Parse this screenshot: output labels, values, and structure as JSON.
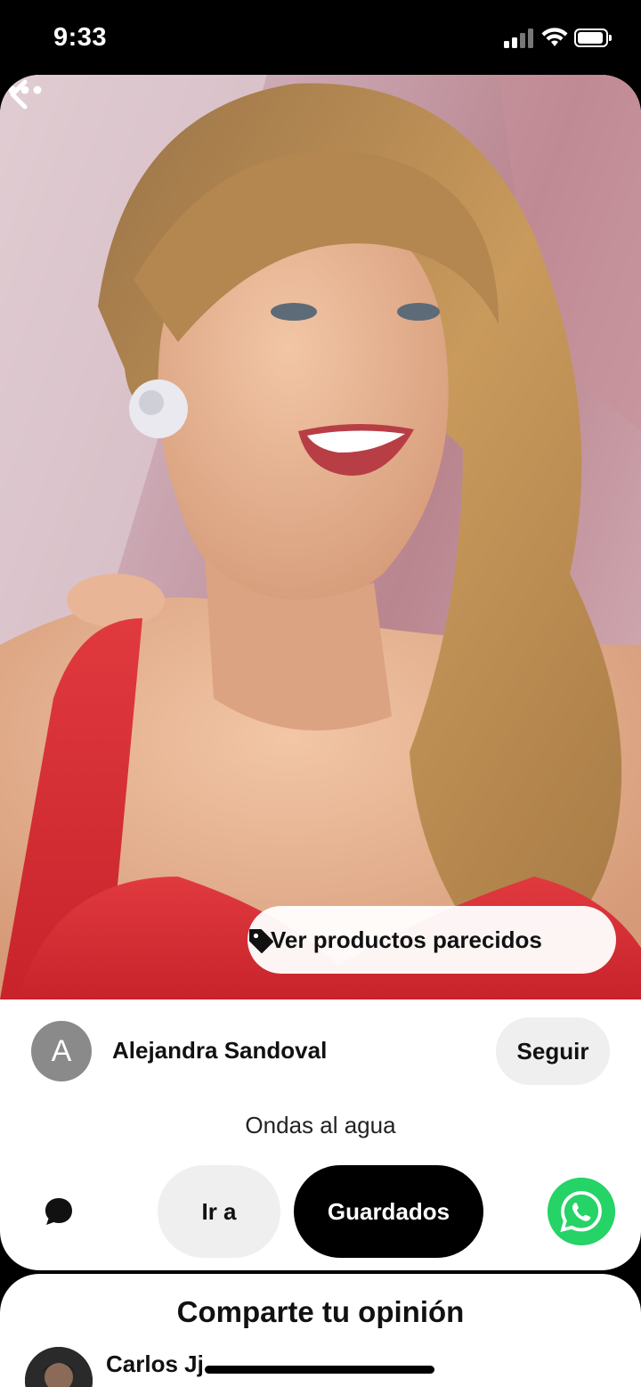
{
  "status_bar": {
    "time": "9:33"
  },
  "pin": {
    "similar_products_label": "Ver productos parecidos",
    "author": {
      "initial": "A",
      "name": "Alejandra Sandoval"
    },
    "follow_label": "Seguir",
    "title": "Ondas al agua",
    "actions": {
      "goto_label": "Ir a",
      "save_label": "Guardados"
    }
  },
  "comments": {
    "heading": "Comparte tu opinión",
    "first_commenter": "Carlos Jj"
  },
  "colors": {
    "save_button": "#000000",
    "whatsapp": "#25d366",
    "follow_button": "#efefef"
  }
}
